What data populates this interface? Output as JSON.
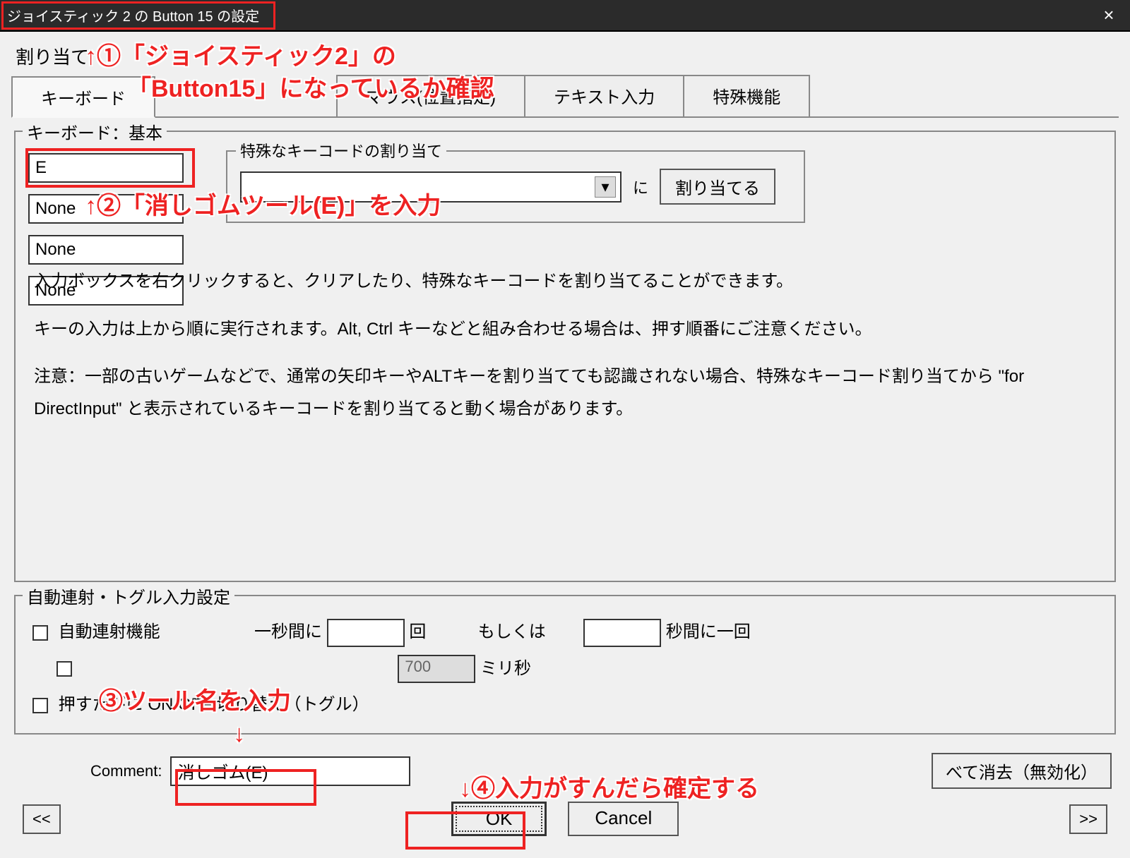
{
  "window": {
    "title": "ジョイスティック 2 の Button 15 の設定",
    "close_icon": "×"
  },
  "subtitle_partial": "割り当て",
  "tabs": {
    "keyboard": "キーボード",
    "mouse_pos": "マウス(位置指定)",
    "text_input": "テキスト入力",
    "special": "特殊機能"
  },
  "keyboard_section": {
    "legend": "キーボード：基本",
    "inputs": [
      "E",
      "None",
      "None",
      "None"
    ],
    "special_legend": "特殊なキーコードの割り当て",
    "ni_label": "に",
    "assign_btn": "割り当てる"
  },
  "info": {
    "p1": "入力ボックスを右クリックすると、クリアしたり、特殊なキーコードを割り当てることができます。",
    "p2": "キーの入力は上から順に実行されます。Alt, Ctrl キーなどと組み合わせる場合は、押す順番にご注意ください。",
    "p3": "注意：一部の古いゲームなどで、通常の矢印キーやALTキーを割り当てても認識されない場合、特殊なキーコード割り当てから \"for DirectInput\" と表示されているキーコードを割り当てると動く場合があります。"
  },
  "autofire": {
    "legend": "自動連射・トグル入力設定",
    "cb_autofire": "自動連射機能",
    "per_sec_before": "一秒間に",
    "per_sec_after": "回",
    "or_label": "もしくは",
    "sec_per": "秒間に一回",
    "delay_value": "700",
    "ms_label": "ミリ秒",
    "cb_toggle": "押すたびに ON/OFF 切り替え（トグル）"
  },
  "comment": {
    "label": "Comment:",
    "value": "消しゴム(E)"
  },
  "footer": {
    "prev": "<<",
    "next": ">>",
    "ok": "OK",
    "cancel": "Cancel",
    "clear_all": "べて消去（無効化）"
  },
  "callouts": {
    "c1a": "↑①「ジョイスティック2」の",
    "c1b": "「Button15」になっているか確認",
    "c2": "↑②「消しゴムツール(E)」を入力",
    "c3": "③ツール名を入力",
    "c3arrow": "↓",
    "c4": "↓④入力がすんだら確定する"
  }
}
